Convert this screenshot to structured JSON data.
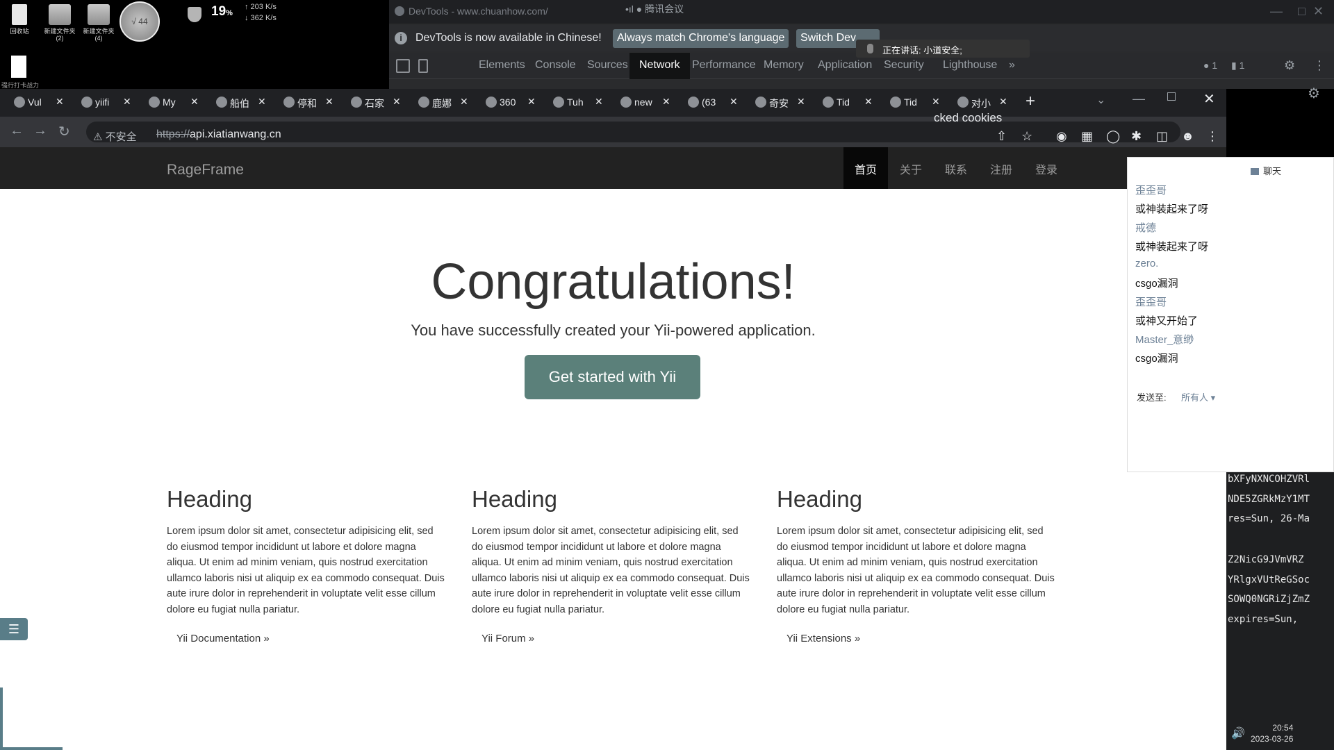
{
  "desktop": {
    "icons": [
      {
        "label": "回收站"
      },
      {
        "label": "新建文件夹\n(2)"
      },
      {
        "label": "新建文件夹\n(4)"
      }
    ],
    "avatar_text": "√ 44",
    "cpu_percent": "19",
    "cpu_unit": "%",
    "net_up": "↑ 203 K/s",
    "net_down": "↓ 362 K/s",
    "caption": "强行打卡战力"
  },
  "devtools": {
    "title": "DevTools - www.chuanhow.com/",
    "meeting": "•ıl ● 腾讯会议",
    "info_message": "DevTools is now available in Chinese!",
    "match_language_button": "Always match Chrome's language",
    "switch_button": "Switch Dev",
    "speaking": "正在讲话: 小道安全;",
    "tabs": [
      "Elements",
      "Console",
      "Sources",
      "Network",
      "Performance",
      "Memory",
      "Application",
      "Security",
      "Lighthouse"
    ],
    "active_tab": "Network",
    "more": "»",
    "errors": "1",
    "messages": "1",
    "cookies_fragment": "cked cookies"
  },
  "browser": {
    "tabs": [
      {
        "label": "Vul"
      },
      {
        "label": "yiifi"
      },
      {
        "label": "My"
      },
      {
        "label": "船伯"
      },
      {
        "label": "停和"
      },
      {
        "label": "石家"
      },
      {
        "label": "鹿娜"
      },
      {
        "label": "360"
      },
      {
        "label": "Tuh"
      },
      {
        "label": "new"
      },
      {
        "label": "(63"
      },
      {
        "label": "奇安"
      },
      {
        "label": "Tid"
      },
      {
        "label": "Tid"
      },
      {
        "label": "对小"
      }
    ],
    "insecure_label": "⚠ 不安全",
    "url_scheme": "https://",
    "url_host": "api.xiatianwang.cn"
  },
  "site": {
    "brand": "RageFrame",
    "nav": [
      "首页",
      "关于",
      "联系",
      "注册",
      "登录"
    ],
    "title": "Congratulations!",
    "lead": "You have successfully created your Yii-powered application.",
    "cta": "Get started with Yii",
    "columns": [
      {
        "heading": "Heading",
        "body": "Lorem ipsum dolor sit amet, consectetur adipisicing elit, sed do eiusmod tempor incididunt ut labore et dolore magna aliqua. Ut enim ad minim veniam, quis nostrud exercitation ullamco laboris nisi ut aliquip ex ea commodo consequat. Duis aute irure dolor in reprehenderit in voluptate velit esse cillum dolore eu fugiat nulla pariatur.",
        "link": "Yii Documentation »"
      },
      {
        "heading": "Heading",
        "body": "Lorem ipsum dolor sit amet, consectetur adipisicing elit, sed do eiusmod tempor incididunt ut labore et dolore magna aliqua. Ut enim ad minim veniam, quis nostrud exercitation ullamco laboris nisi ut aliquip ex ea commodo consequat. Duis aute irure dolor in reprehenderit in voluptate velit esse cillum dolore eu fugiat nulla pariatur.",
        "link": "Yii Forum »"
      },
      {
        "heading": "Heading",
        "body": "Lorem ipsum dolor sit amet, consectetur adipisicing elit, sed do eiusmod tempor incididunt ut labore et dolore magna aliqua. Ut enim ad minim veniam, quis nostrud exercitation ullamco laboris nisi ut aliquip ex ea commodo consequat. Duis aute irure dolor in reprehenderit in voluptate velit esse cillum dolore eu fugiat nulla pariatur.",
        "link": "Yii Extensions »"
      }
    ]
  },
  "chat": {
    "title": "聊天",
    "messages": [
      {
        "user": "歪歪哥",
        "text": "或神装起来了呀"
      },
      {
        "user": "戒德",
        "text": "或神装起来了呀"
      },
      {
        "user": "zero.",
        "text": "csgo漏洞"
      },
      {
        "user": "歪歪哥",
        "text": "或神又开始了"
      },
      {
        "user": "Master_意缈",
        "text": "csgo漏洞"
      }
    ],
    "send_to_label": "发送至:",
    "send_to_value": "所有人 ▾"
  },
  "code_lines": [
    "bXFyNXNCOHZVRl",
    "NDE5ZGRkMzY1MT",
    "res=Sun, 26-Ma",
    "Z2NicG9JVmVRZ",
    "YRlgxVUtReGSoc",
    "SOWQ0NGRiZjZmZ",
    " expires=Sun,"
  ],
  "taskbar": {
    "time": "20:54",
    "date": "2023-03-26"
  },
  "colors": {
    "cta": "#5b807a",
    "navbar": "#222222",
    "chat_user": "#6d8196"
  }
}
